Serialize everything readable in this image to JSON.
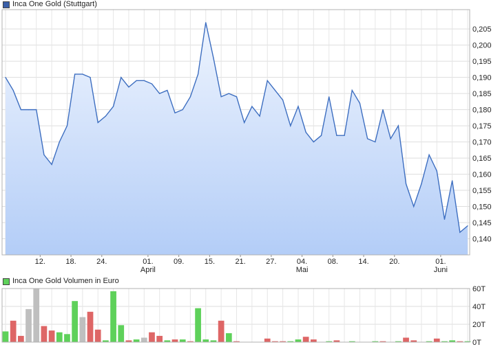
{
  "chart_data": [
    {
      "type": "area",
      "legend": "Inca One Gold (Stuttgart)",
      "series_color": "#3d6ec0",
      "fill_top": "#eef4fe",
      "fill_bottom": "#b3cdf7",
      "ylim": [
        0.135,
        0.211
      ],
      "y_ticks": [
        "0,140",
        "0,145",
        "0,150",
        "0,155",
        "0,160",
        "0,165",
        "0,170",
        "0,175",
        "0,180",
        "0,185",
        "0,190",
        "0,195",
        "0,200",
        "0,205"
      ],
      "y_tick_values": [
        0.14,
        0.145,
        0.15,
        0.155,
        0.16,
        0.165,
        0.17,
        0.175,
        0.18,
        0.185,
        0.19,
        0.195,
        0.2,
        0.205
      ],
      "x_ticks": [
        {
          "label": "12.",
          "month": "",
          "index": 4.5
        },
        {
          "label": "18.",
          "month": "",
          "index": 8.5
        },
        {
          "label": "24.",
          "month": "",
          "index": 12.5
        },
        {
          "label": "01.",
          "month": "April",
          "index": 18.5
        },
        {
          "label": "09.",
          "month": "",
          "index": 22.5
        },
        {
          "label": "15.",
          "month": "",
          "index": 26.5
        },
        {
          "label": "21.",
          "month": "",
          "index": 30.5
        },
        {
          "label": "27.",
          "month": "",
          "index": 34.5
        },
        {
          "label": "04.",
          "month": "Mai",
          "index": 38.5
        },
        {
          "label": "08.",
          "month": "",
          "index": 42.5
        },
        {
          "label": "14.",
          "month": "",
          "index": 46.5
        },
        {
          "label": "20.",
          "month": "",
          "index": 50.5
        },
        {
          "label": "01.",
          "month": "Juni",
          "index": 56.5
        }
      ],
      "values": [
        0.19,
        0.186,
        0.18,
        0.18,
        0.18,
        0.166,
        0.163,
        0.17,
        0.175,
        0.191,
        0.191,
        0.19,
        0.176,
        0.178,
        0.181,
        0.19,
        0.187,
        0.189,
        0.189,
        0.188,
        0.185,
        0.186,
        0.179,
        0.18,
        0.184,
        0.191,
        0.207,
        0.196,
        0.184,
        0.185,
        0.184,
        0.176,
        0.181,
        0.178,
        0.189,
        0.186,
        0.183,
        0.175,
        0.181,
        0.173,
        0.17,
        0.172,
        0.184,
        0.172,
        0.172,
        0.186,
        0.182,
        0.171,
        0.17,
        0.18,
        0.171,
        0.175,
        0.157,
        0.15,
        0.157,
        0.166,
        0.161,
        0.146,
        0.158,
        0.142,
        0.144
      ]
    },
    {
      "type": "bar",
      "legend": "Inca One Gold Volumen in Euro",
      "legend_color": "#5ed15a",
      "colors": {
        "up": "#5ed15a",
        "down": "#de6666",
        "flat": "#bfbfbf"
      },
      "ylim": [
        0,
        60
      ],
      "y_ticks": [
        "0T",
        "20T",
        "40T",
        "60T"
      ],
      "y_tick_values": [
        0,
        20,
        40,
        60
      ],
      "bars": [
        {
          "v": 12,
          "d": "up"
        },
        {
          "v": 24,
          "d": "down"
        },
        {
          "v": 7,
          "d": "down"
        },
        {
          "v": 37,
          "d": "flat"
        },
        {
          "v": 60,
          "d": "flat"
        },
        {
          "v": 18,
          "d": "down"
        },
        {
          "v": 13,
          "d": "down"
        },
        {
          "v": 11,
          "d": "up"
        },
        {
          "v": 9,
          "d": "up"
        },
        {
          "v": 46,
          "d": "up"
        },
        {
          "v": 28,
          "d": "flat"
        },
        {
          "v": 34,
          "d": "down"
        },
        {
          "v": 14,
          "d": "down"
        },
        {
          "v": 2,
          "d": "up"
        },
        {
          "v": 57,
          "d": "up"
        },
        {
          "v": 19,
          "d": "up"
        },
        {
          "v": 2,
          "d": "down"
        },
        {
          "v": 3,
          "d": "up"
        },
        {
          "v": 5,
          "d": "flat"
        },
        {
          "v": 11,
          "d": "down"
        },
        {
          "v": 7,
          "d": "down"
        },
        {
          "v": 2,
          "d": "up"
        },
        {
          "v": 3,
          "d": "down"
        },
        {
          "v": 3,
          "d": "up"
        },
        {
          "v": 1,
          "d": "down"
        },
        {
          "v": 38,
          "d": "up"
        },
        {
          "v": 3,
          "d": "up"
        },
        {
          "v": 2,
          "d": "up"
        },
        {
          "v": 24,
          "d": "down"
        },
        {
          "v": 10,
          "d": "up"
        },
        {
          "v": 1,
          "d": "down"
        },
        {
          "v": 0,
          "d": "up"
        },
        {
          "v": 0,
          "d": "up"
        },
        {
          "v": 0,
          "d": "up"
        },
        {
          "v": 4,
          "d": "down"
        },
        {
          "v": 1,
          "d": "down"
        },
        {
          "v": 1,
          "d": "down"
        },
        {
          "v": 1,
          "d": "up"
        },
        {
          "v": 3,
          "d": "up"
        },
        {
          "v": 6,
          "d": "down"
        },
        {
          "v": 3,
          "d": "down"
        },
        {
          "v": 0,
          "d": "up"
        },
        {
          "v": 1,
          "d": "up"
        },
        {
          "v": 2,
          "d": "down"
        },
        {
          "v": 0,
          "d": "up"
        },
        {
          "v": 1,
          "d": "up"
        },
        {
          "v": 0,
          "d": "up"
        },
        {
          "v": 0,
          "d": "up"
        },
        {
          "v": 1,
          "d": "up"
        },
        {
          "v": 1,
          "d": "down"
        },
        {
          "v": 0,
          "d": "up"
        },
        {
          "v": 1,
          "d": "up"
        },
        {
          "v": 5,
          "d": "down"
        },
        {
          "v": 2,
          "d": "down"
        },
        {
          "v": 0,
          "d": "up"
        },
        {
          "v": 1,
          "d": "up"
        },
        {
          "v": 4,
          "d": "down"
        },
        {
          "v": 1,
          "d": "up"
        },
        {
          "v": 2,
          "d": "up"
        },
        {
          "v": 1,
          "d": "down"
        },
        {
          "v": 1,
          "d": "up"
        }
      ]
    }
  ]
}
